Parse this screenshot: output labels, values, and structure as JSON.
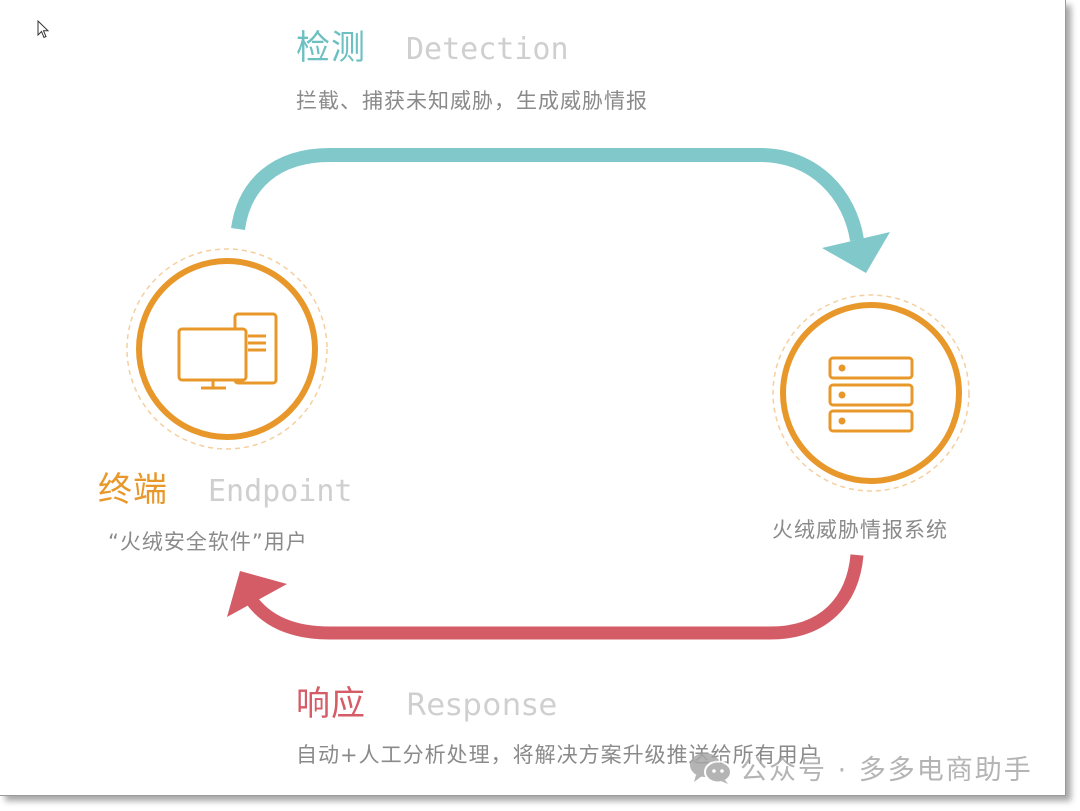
{
  "colors": {
    "detection": "#80c8ca",
    "response": "#d45c66",
    "node": "#e8982a",
    "node_dashed": "#f5cf9f",
    "subtitle": "#cfcfcf",
    "description": "#8a8a8a"
  },
  "detection": {
    "title_cn": "检测",
    "title_en": "Detection",
    "description": "拦截、捕获未知威胁，生成威胁情报"
  },
  "endpoint": {
    "title_cn": "终端",
    "title_en": "Endpoint",
    "description": "“火绒安全软件”用户",
    "icon": "desktop-computer-icon"
  },
  "system": {
    "description": "火绒威胁情报系统",
    "icon": "server-stack-icon"
  },
  "response": {
    "title_cn": "响应",
    "title_en": "Response",
    "description": "自动+人工分析处理，将解决方案升级推送给所有用户"
  },
  "watermark": {
    "icon": "wechat-icon",
    "text": "公众号 · 多多电商助手"
  }
}
